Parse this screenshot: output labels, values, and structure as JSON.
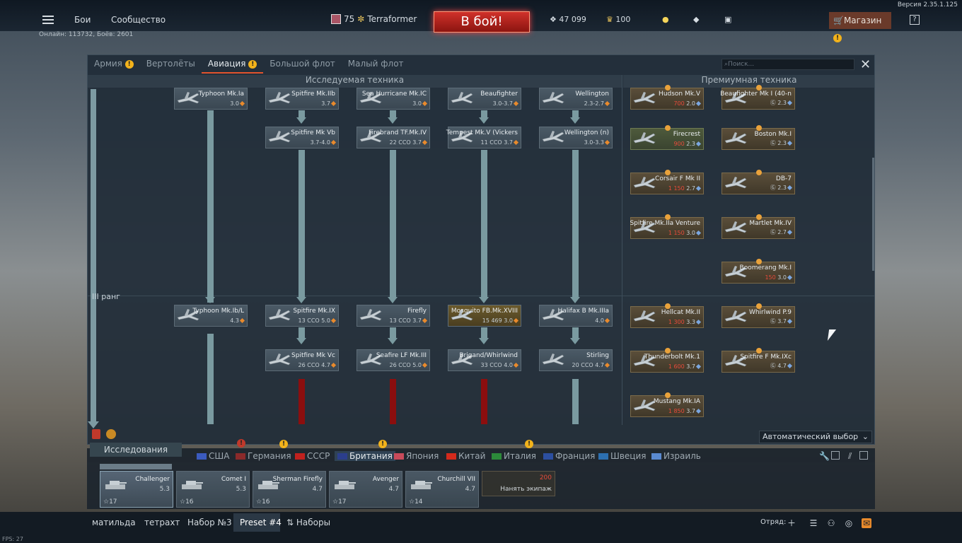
{
  "version": "Версия 2.35.1.125",
  "topnav": {
    "battles": "Бои",
    "community": "Сообщество",
    "online": "Онлайн: 113732, Боёв: 2601",
    "level": "75",
    "nickname": "Terraformer",
    "battle_button": "В бой!",
    "silver": "47 099",
    "gold": "100",
    "shop": "Магазин",
    "help": "?"
  },
  "tabs": [
    {
      "label": "Армия",
      "warn": true
    },
    {
      "label": "Вертолёты",
      "warn": false
    },
    {
      "label": "Авиация",
      "warn": true,
      "active": true
    },
    {
      "label": "Большой флот",
      "warn": false
    },
    {
      "label": "Малый флот",
      "warn": false
    }
  ],
  "search_placeholder": "Поиск...",
  "headers": {
    "researchable": "Исследуемая техника",
    "premium": "Премиумная техника"
  },
  "rank_label": "III ранг",
  "tree": [
    {
      "name": "Typhoon Mk.Ia",
      "stats": "3.0"
    },
    {
      "name": "Spitfire Mk.IIb",
      "stats": "3.7"
    },
    {
      "name": "Sea Hurricane Mk.IC",
      "stats": "3.0"
    },
    {
      "name": "Beaufighter",
      "stats": "3.0-3.7"
    },
    {
      "name": "Wellington",
      "stats": "2.3-2.7"
    },
    {
      "name": "Spitfire Mk Vb",
      "stats": "3.7-4.0"
    },
    {
      "name": "Firebrand TF.Mk.IV",
      "stats": "22 ССО 3.7"
    },
    {
      "name": "Tempest Mk.V (Vickers",
      "stats": "11 ССО 3.7"
    },
    {
      "name": "Wellington (n)",
      "stats": "3.0-3.3"
    },
    {
      "name": "Typhoon Mk.Ib/L",
      "stats": "4.3"
    },
    {
      "name": "Spitfire Mk.IX",
      "stats": "13 ССО 5.0"
    },
    {
      "name": "Firefly",
      "stats": "13 ССО 3.7"
    },
    {
      "name": "Mosquito FB.Mk.XVIII",
      "stats": "15 469 3.0"
    },
    {
      "name": "Halifax B Mk.IIIa",
      "stats": "4.0"
    },
    {
      "name": "Spitfire Mk Vc",
      "stats": "26 ССО 4.7"
    },
    {
      "name": "Seafire LF Mk.III",
      "stats": "26 ССО 5.0"
    },
    {
      "name": "Brigand/Whirlwind",
      "stats": "33 ССО 4.0"
    },
    {
      "name": "Stirling",
      "stats": "20 ССО 4.7"
    }
  ],
  "premium": [
    {
      "name": "Hudson Mk.V",
      "price": "700",
      "br": "2.0"
    },
    {
      "name": "Beaufighter Mk I (40-n",
      "price": "",
      "br": "2.3"
    },
    {
      "name": "Firecrest",
      "price": "900",
      "br": "2.3"
    },
    {
      "name": "Boston Mk.I",
      "price": "",
      "br": "2.3"
    },
    {
      "name": "Corsair F Mk II",
      "price": "1 150",
      "br": "2.7"
    },
    {
      "name": "DB-7",
      "price": "",
      "br": "2.3"
    },
    {
      "name": "Spitfire Mk.IIa Venture",
      "price": "1 150",
      "br": "3.0"
    },
    {
      "name": "Martlet Mk.IV",
      "price": "",
      "br": "2.7"
    },
    {
      "name": "Boomerang Mk.I",
      "price": "150",
      "br": "3.0"
    },
    {
      "name": "Hellcat Mk.II",
      "price": "1 300",
      "br": "3.3"
    },
    {
      "name": "Whirlwind P.9",
      "price": "",
      "br": "3.7"
    },
    {
      "name": "Thunderbolt Mk.1",
      "price": "1 600",
      "br": "3.7"
    },
    {
      "name": "Spitfire F Mk.IXc",
      "price": "",
      "br": "4.7"
    },
    {
      "name": "Mustang Mk.IA",
      "price": "1 850",
      "br": "3.7"
    }
  ],
  "auto_select": "Автоматический выбор",
  "research_tab": "Исследования",
  "nations": [
    {
      "label": "США"
    },
    {
      "label": "Германия"
    },
    {
      "label": "СССР"
    },
    {
      "label": "Британия",
      "active": true
    },
    {
      "label": "Япония"
    },
    {
      "label": "Китай"
    },
    {
      "label": "Италия"
    },
    {
      "label": "Франция"
    },
    {
      "label": "Швеция"
    },
    {
      "label": "Израиль"
    }
  ],
  "vehicles": [
    {
      "name": "Challenger",
      "br": "5.3",
      "lvl": "17"
    },
    {
      "name": "Comet I",
      "br": "5.3",
      "lvl": "16"
    },
    {
      "name": "Sherman Firefly",
      "br": "4.7",
      "lvl": "16"
    },
    {
      "name": "Avenger",
      "br": "4.7",
      "lvl": "17"
    },
    {
      "name": "Churchill VII",
      "br": "4.7",
      "lvl": "14"
    }
  ],
  "crew": {
    "price": "200",
    "label": "Нанять экипаж"
  },
  "presets": [
    "матильда",
    "тетрахт",
    "Набор №3",
    "Preset #4",
    "Наборы"
  ],
  "squad": "Отряд:",
  "fps": "FPS: 27"
}
